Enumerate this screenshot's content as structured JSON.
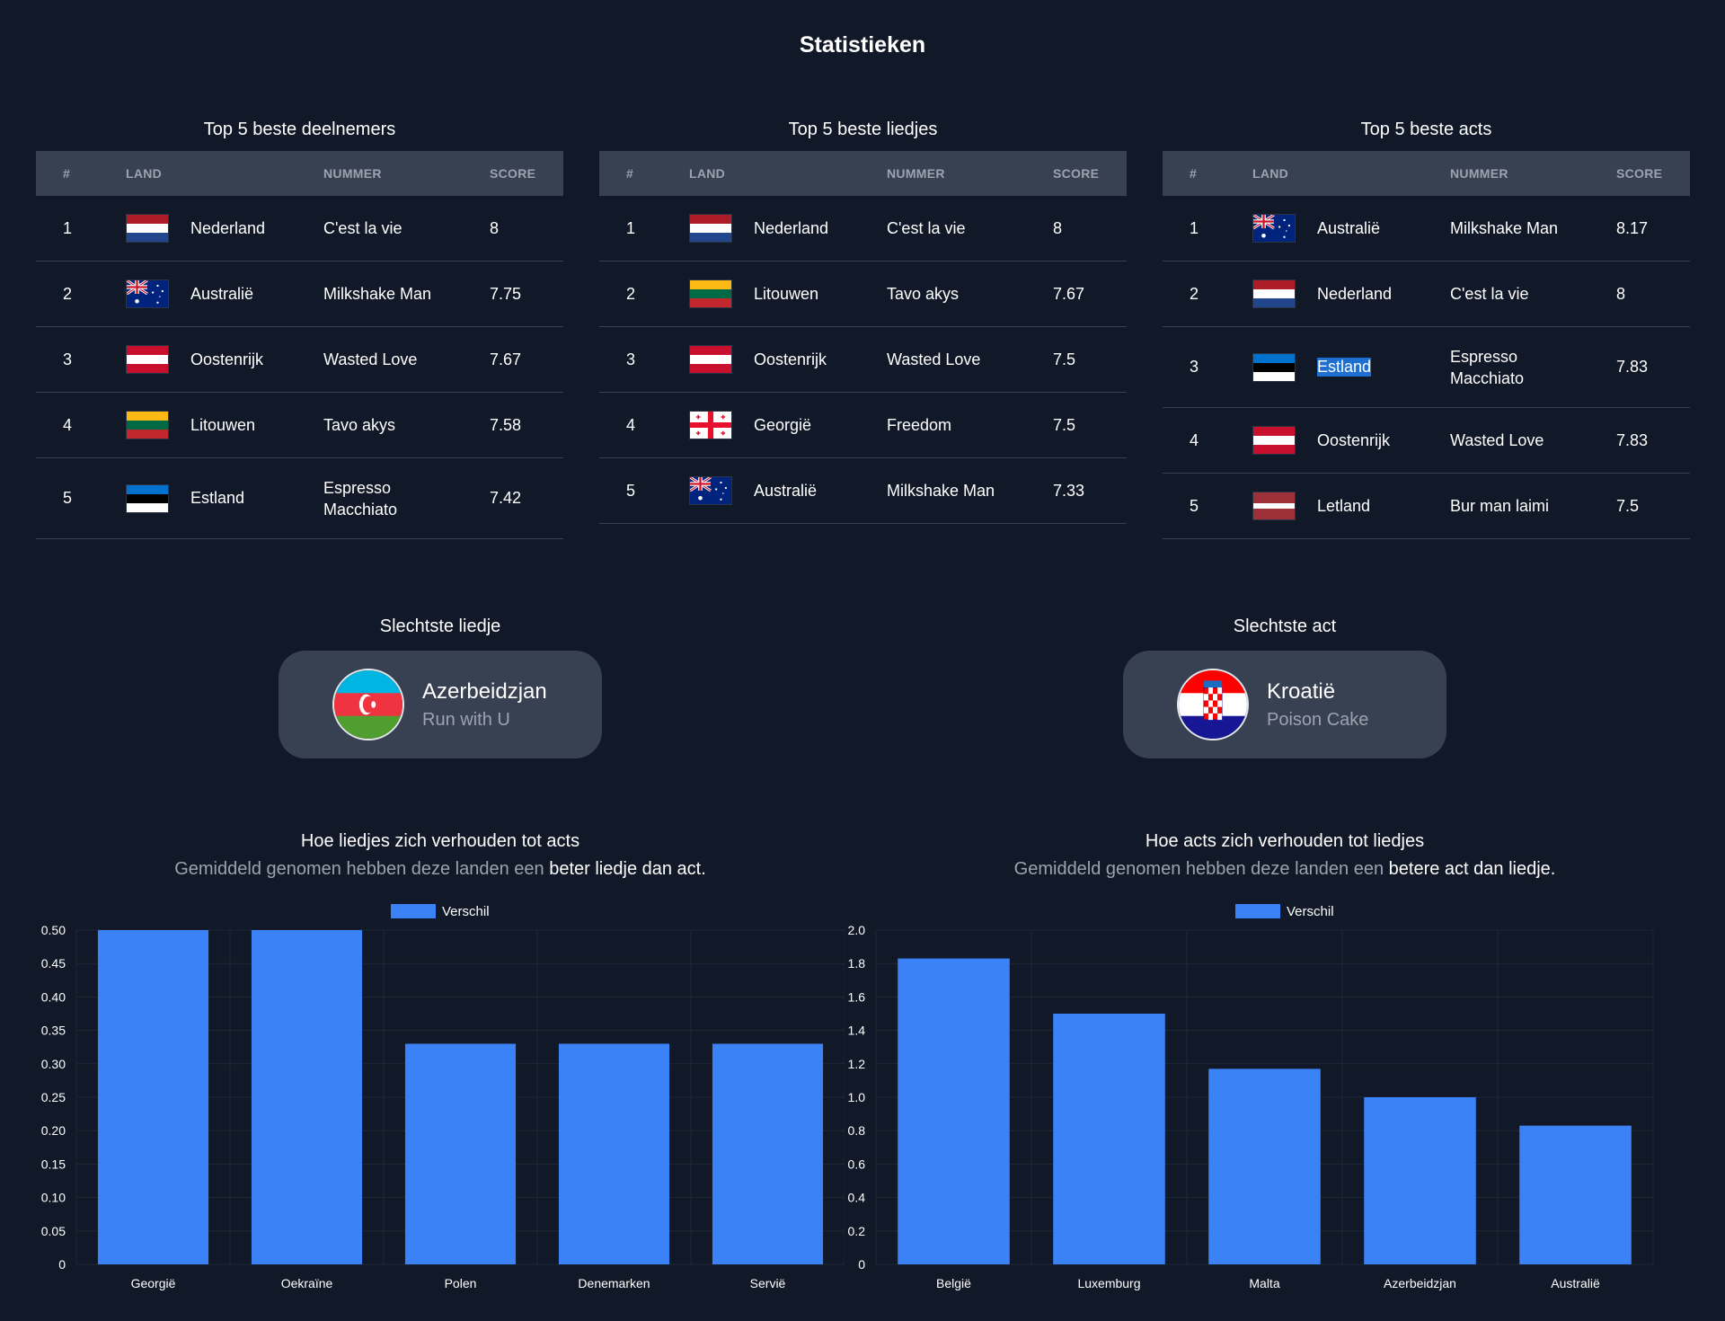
{
  "page": {
    "title": "Statistieken"
  },
  "headers": {
    "rank": "#",
    "land": "LAND",
    "song": "NUMMER",
    "score": "SCORE"
  },
  "tables": [
    {
      "title": "Top 5 beste deelnemers",
      "rows": [
        {
          "rank": "1",
          "flag": "flag-nl",
          "country": "Nederland",
          "song": "C'est la vie",
          "score": "8"
        },
        {
          "rank": "2",
          "flag": "flag-au",
          "country": "Australië",
          "song": "Milkshake Man",
          "score": "7.75"
        },
        {
          "rank": "3",
          "flag": "flag-at",
          "country": "Oostenrijk",
          "song": "Wasted Love",
          "score": "7.67"
        },
        {
          "rank": "4",
          "flag": "flag-lt",
          "country": "Litouwen",
          "song": "Tavo akys",
          "score": "7.58"
        },
        {
          "rank": "5",
          "flag": "flag-ee",
          "country": "Estland",
          "song": "Espresso Macchiato",
          "score": "7.42"
        }
      ]
    },
    {
      "title": "Top 5 beste liedjes",
      "rows": [
        {
          "rank": "1",
          "flag": "flag-nl",
          "country": "Nederland",
          "song": "C'est la vie",
          "score": "8"
        },
        {
          "rank": "2",
          "flag": "flag-lt",
          "country": "Litouwen",
          "song": "Tavo akys",
          "score": "7.67"
        },
        {
          "rank": "3",
          "flag": "flag-at",
          "country": "Oostenrijk",
          "song": "Wasted Love",
          "score": "7.5"
        },
        {
          "rank": "4",
          "flag": "flag-ge",
          "country": "Georgië",
          "song": "Freedom",
          "score": "7.5"
        },
        {
          "rank": "5",
          "flag": "flag-au",
          "country": "Australië",
          "song": "Milkshake Man",
          "score": "7.33"
        }
      ]
    },
    {
      "title": "Top 5 beste acts",
      "rows": [
        {
          "rank": "1",
          "flag": "flag-au",
          "country": "Australië",
          "song": "Milkshake Man",
          "score": "8.17"
        },
        {
          "rank": "2",
          "flag": "flag-nl",
          "country": "Nederland",
          "song": "C'est la vie",
          "score": "8"
        },
        {
          "rank": "3",
          "flag": "flag-ee",
          "country": "Estland",
          "song": "Espresso Macchiato",
          "score": "7.83",
          "selected": true
        },
        {
          "rank": "4",
          "flag": "flag-at",
          "country": "Oostenrijk",
          "song": "Wasted Love",
          "score": "7.83"
        },
        {
          "rank": "5",
          "flag": "flag-lv",
          "country": "Letland",
          "song": "Bur man laimi",
          "score": "7.5"
        }
      ]
    }
  ],
  "worst": [
    {
      "title": "Slechtste liedje",
      "flag": "flag-az",
      "country": "Azerbeidzjan",
      "song": "Run with U"
    },
    {
      "title": "Slechtste act",
      "flag": "flag-hr",
      "country": "Kroatië",
      "song": "Poison Cake"
    }
  ],
  "chart_headers": [
    {
      "title": "Hoe liedjes zich verhouden tot acts",
      "sub_prefix": "Gemiddeld genomen hebben deze landen een ",
      "sub_emph": "beter liedje dan act."
    },
    {
      "title": "Hoe acts zich verhouden tot liedjes",
      "sub_prefix": "Gemiddeld genomen hebben deze landen een ",
      "sub_emph": "betere act dan liedje."
    }
  ],
  "chart_data": [
    {
      "type": "bar",
      "categories": [
        "Georgië",
        "Oekraïne",
        "Polen",
        "Denemarken",
        "Servië"
      ],
      "series": [
        {
          "name": "Verschil",
          "values": [
            0.5,
            0.5,
            0.33,
            0.33,
            0.33
          ]
        }
      ],
      "ylim": [
        0,
        0.5
      ],
      "yticks": [
        "0.50",
        "0.45",
        "0.40",
        "0.35",
        "0.30",
        "0.25",
        "0.20",
        "0.15",
        "0.10",
        "0.05",
        "0"
      ],
      "legend": "top-center",
      "grid": true,
      "color": "#3b82f6"
    },
    {
      "type": "bar",
      "categories": [
        "België",
        "Luxemburg",
        "Malta",
        "Azerbeidzjan",
        "Australië"
      ],
      "series": [
        {
          "name": "Verschil",
          "values": [
            1.83,
            1.5,
            1.17,
            1.0,
            0.83
          ]
        }
      ],
      "ylim": [
        0,
        2.0
      ],
      "yticks": [
        "2.0",
        "1.8",
        "1.6",
        "1.4",
        "1.2",
        "1.0",
        "0.8",
        "0.6",
        "0.4",
        "0.2",
        "0"
      ],
      "legend": "top-center",
      "grid": true,
      "color": "#3b82f6"
    }
  ]
}
